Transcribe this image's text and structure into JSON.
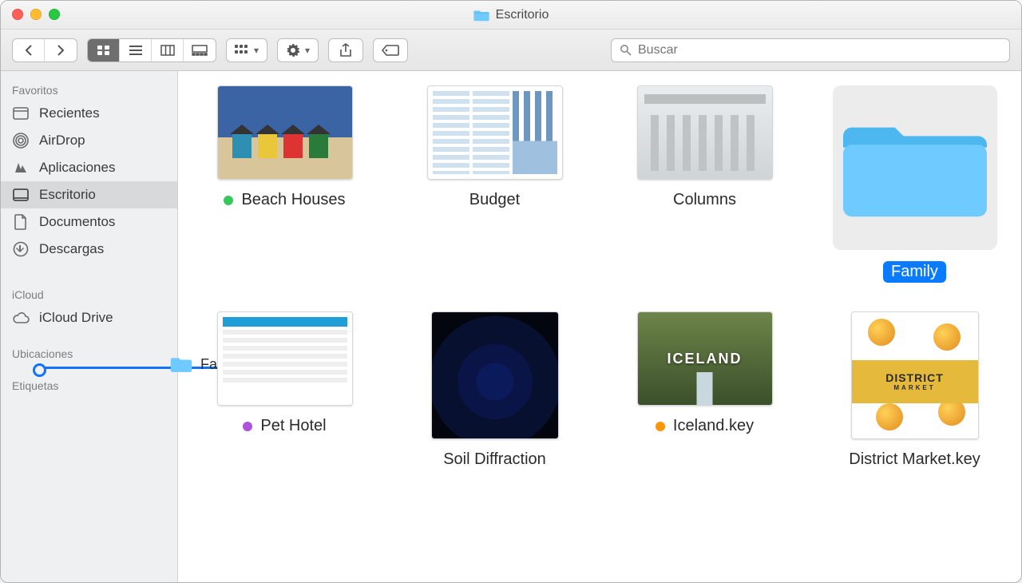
{
  "window": {
    "title": "Escritorio"
  },
  "search": {
    "placeholder": "Buscar"
  },
  "sidebar": {
    "sections": [
      {
        "header": "Favoritos",
        "items": [
          {
            "label": "Recientes",
            "icon": "clock"
          },
          {
            "label": "AirDrop",
            "icon": "airdrop"
          },
          {
            "label": "Aplicaciones",
            "icon": "apps"
          },
          {
            "label": "Escritorio",
            "icon": "desktop",
            "selected": true
          },
          {
            "label": "Documentos",
            "icon": "documents"
          },
          {
            "label": "Descargas",
            "icon": "downloads"
          }
        ]
      },
      {
        "header": "iCloud",
        "items": [
          {
            "label": "iCloud Drive",
            "icon": "cloud"
          }
        ]
      },
      {
        "header": "Ubicaciones",
        "items": []
      },
      {
        "header": "Etiquetas",
        "items": []
      }
    ]
  },
  "drag": {
    "label": "Family"
  },
  "items": [
    {
      "name": "Beach Houses",
      "tag": "#34c759",
      "kind": "image",
      "selected": false
    },
    {
      "name": "Budget",
      "tag": null,
      "kind": "sheet",
      "selected": false
    },
    {
      "name": "Columns",
      "tag": null,
      "kind": "image",
      "selected": false
    },
    {
      "name": "Family",
      "tag": null,
      "kind": "folder",
      "selected": true
    },
    {
      "name": "Pet Hotel",
      "tag": "#af52de",
      "kind": "sheet",
      "selected": false
    },
    {
      "name": "Soil Diffraction",
      "tag": null,
      "kind": "image",
      "selected": false
    },
    {
      "name": "Iceland.key",
      "tag": "#ff9500",
      "kind": "key",
      "selected": false
    },
    {
      "name": "District Market.key",
      "tag": null,
      "kind": "key",
      "selected": false
    }
  ],
  "colors": {
    "accent": "#0a7bff",
    "folder": "#63c8ff"
  }
}
